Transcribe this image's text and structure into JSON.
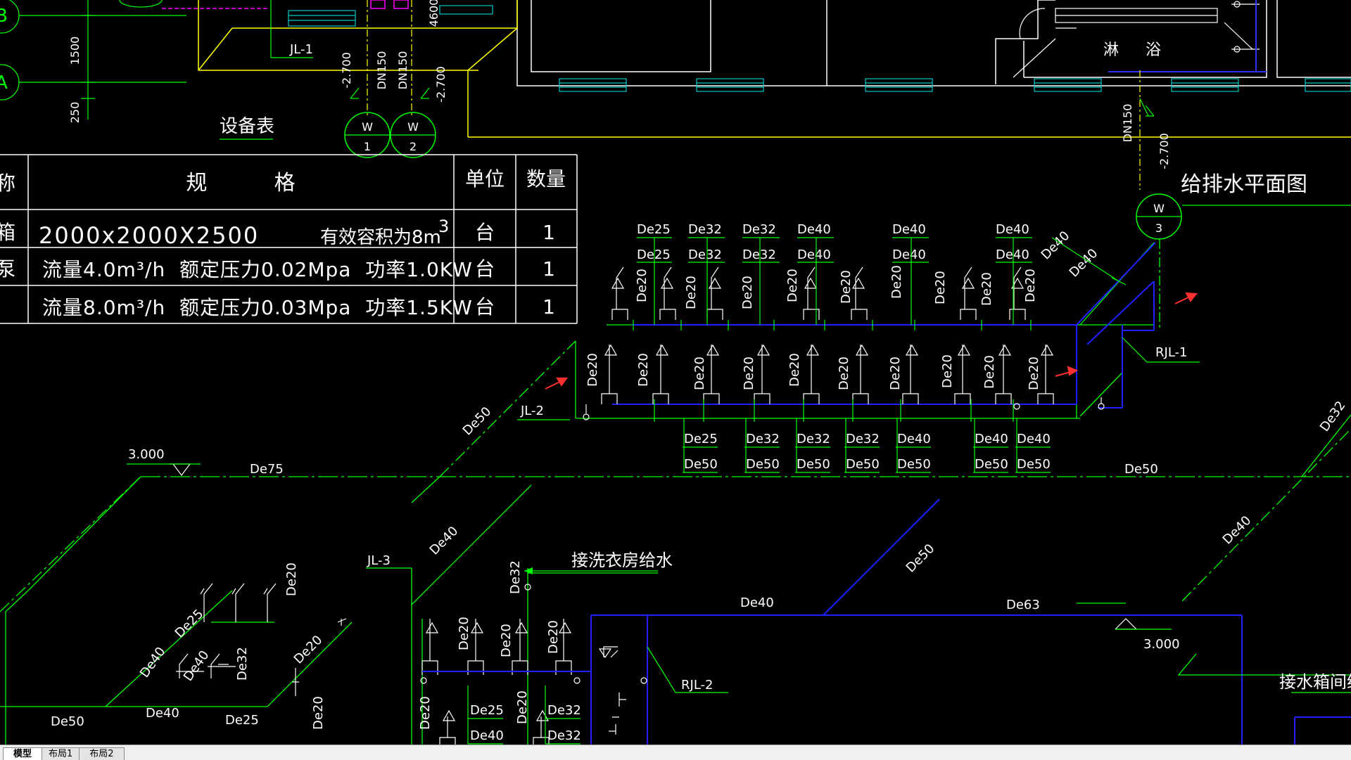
{
  "drawing": {
    "equipment_table": {
      "title": "设备表",
      "headers": {
        "spec": "规          格",
        "unit": "单位",
        "qty": "数量",
        "name": "称"
      },
      "rows": [
        {
          "name": "箱",
          "spec": "2000x2000X2500",
          "spec_extra": "有效容积为8m",
          "spec_sup": "3",
          "unit": "台",
          "qty": "1"
        },
        {
          "name": "泵",
          "spec": "流量4.0m³/h  额定压力0.02Mpa  功率1.0KW",
          "unit": "台",
          "qty": "1"
        },
        {
          "name": "",
          "spec": "流量8.0m³/h  额定压力0.03Mpa  功率1.5KW",
          "unit": "台",
          "qty": "1"
        }
      ]
    },
    "titles": {
      "plan": "给排水平面图",
      "laundry": "接洗衣房给水",
      "tank_room": "接水箱间给水",
      "toilet": "淋",
      "bath": "浴"
    },
    "markers": [
      {
        "letter": "W",
        "num": "1"
      },
      {
        "letter": "W",
        "num": "2"
      },
      {
        "letter": "W",
        "num": "3"
      }
    ],
    "grid_labels": {
      "b": "B",
      "a": "A"
    },
    "dims": {
      "d1500": "1500",
      "d250": "250",
      "d4600": "4600"
    },
    "risers": {
      "jl1": "JL-1",
      "jl2": "JL-2",
      "jl3": "JL-3",
      "rjl1": "RJL-1",
      "rjl2": "RJL-2"
    },
    "pipe_dn": {
      "dn150": "DN150",
      "minus27": "-2.700"
    },
    "elevations": {
      "e3000": "3.000"
    },
    "pipe_sizes": {
      "de20": "De20",
      "de25": "De25",
      "de32": "De32",
      "de40": "De40",
      "de50": "De50",
      "de63": "De63",
      "de75": "De75"
    }
  },
  "layout_tabs": [
    {
      "label": "模型",
      "active": true
    },
    {
      "label": "布局1",
      "active": false
    },
    {
      "label": "布局2",
      "active": false
    }
  ]
}
